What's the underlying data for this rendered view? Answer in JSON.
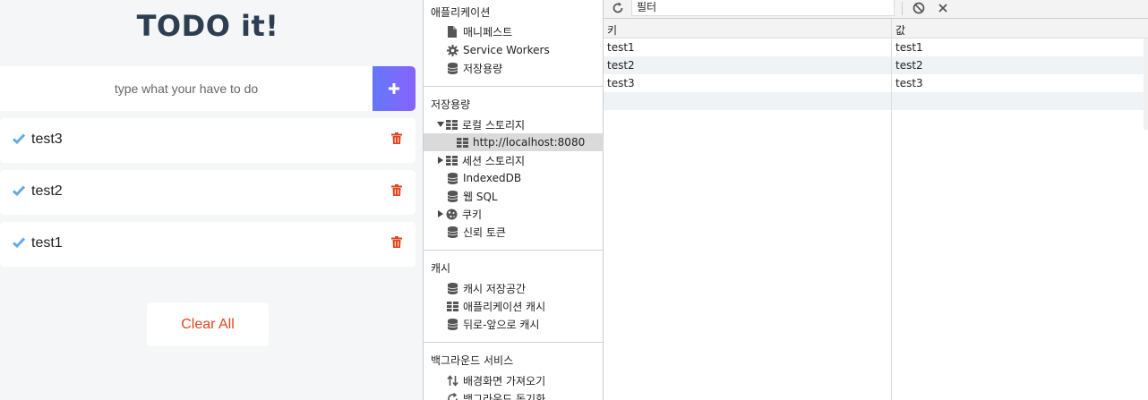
{
  "todo": {
    "title": "TODO it!",
    "input_placeholder": "type what your have to do",
    "items": [
      "test3",
      "test2",
      "test1"
    ],
    "clear_label": "Clear All"
  },
  "sidebar": {
    "application_title": "애플리케이션",
    "application_items": [
      {
        "label": "매니페스트",
        "icon": "file-icon"
      },
      {
        "label": "Service Workers",
        "icon": "gear-icon"
      },
      {
        "label": "저장용량",
        "icon": "database-icon"
      }
    ],
    "storage_title": "저장용량",
    "storage_items": [
      {
        "label": "로컬 스토리지",
        "icon": "grid-icon"
      },
      {
        "label": "http://localhost:8080",
        "icon": "grid-icon"
      },
      {
        "label": "세션 스토리지",
        "icon": "grid-icon"
      },
      {
        "label": "IndexedDB",
        "icon": "database-icon"
      },
      {
        "label": "웹 SQL",
        "icon": "database-icon"
      },
      {
        "label": "쿠키",
        "icon": "cookie-icon"
      },
      {
        "label": "신뢰 토큰",
        "icon": "database-icon"
      }
    ],
    "cache_title": "캐시",
    "cache_items": [
      {
        "label": "캐시 저장공간",
        "icon": "database-icon"
      },
      {
        "label": "애플리케이션 캐시",
        "icon": "grid-icon"
      },
      {
        "label": "뒤로-앞으로 캐시",
        "icon": "database-icon"
      }
    ],
    "background_title": "백그라운드 서비스",
    "background_items": [
      {
        "label": "배경화면 가져오기",
        "icon": "fetch-arrows-icon"
      },
      {
        "label": "백그라운드 동기화",
        "icon": "sync-icon"
      }
    ]
  },
  "panel": {
    "filter_placeholder": "필터",
    "col_key": "키",
    "col_value": "값",
    "rows": [
      {
        "key": "test1",
        "value": "test1"
      },
      {
        "key": "test2",
        "value": "test2"
      },
      {
        "key": "test3",
        "value": "test3"
      }
    ]
  },
  "colors": {
    "accent_gradient_start": "#6478fb",
    "accent_gradient_end": "#8763fb",
    "check": "#62acde",
    "trash": "#e2431f",
    "title": "#2c3e50"
  }
}
